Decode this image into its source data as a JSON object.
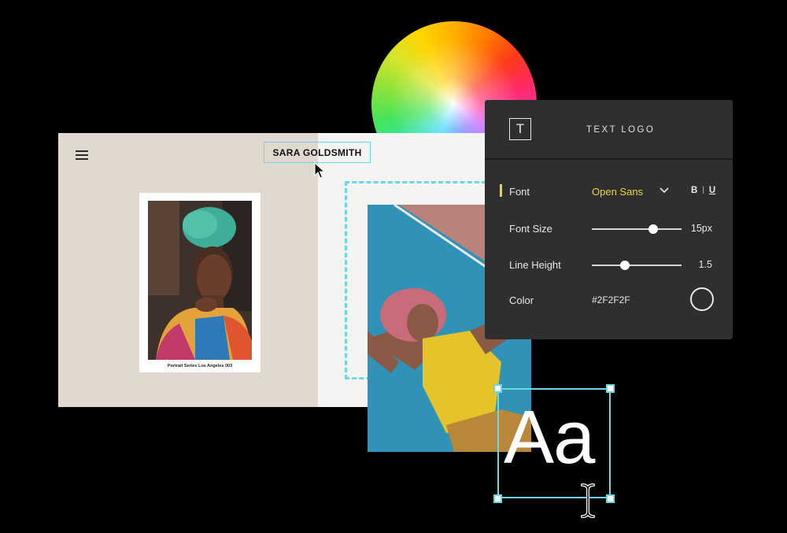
{
  "site": {
    "menu_icon": "hamburger-menu-icon",
    "title": "SARA GOLDSMITH",
    "polaroid_caption": "Portrait Series Los Angeles 003"
  },
  "panel": {
    "icon": "text-t-icon",
    "title": "TEXT LOGO",
    "font": {
      "label": "Font",
      "value": "Open Sans",
      "bold": "B",
      "separator": "|",
      "underline": "U"
    },
    "font_size": {
      "label": "Font Size",
      "value": "15px",
      "level": 0.68
    },
    "line_height": {
      "label": "Line Height",
      "value": "1.5",
      "level": 0.37
    },
    "color": {
      "label": "Color",
      "value": "#2F2F2F"
    }
  },
  "text_element": {
    "sample": "Aa"
  },
  "colors": {
    "accent": "#f2d23a",
    "selection": "#6ad7e6",
    "panel_bg": "#2f2f2f"
  }
}
